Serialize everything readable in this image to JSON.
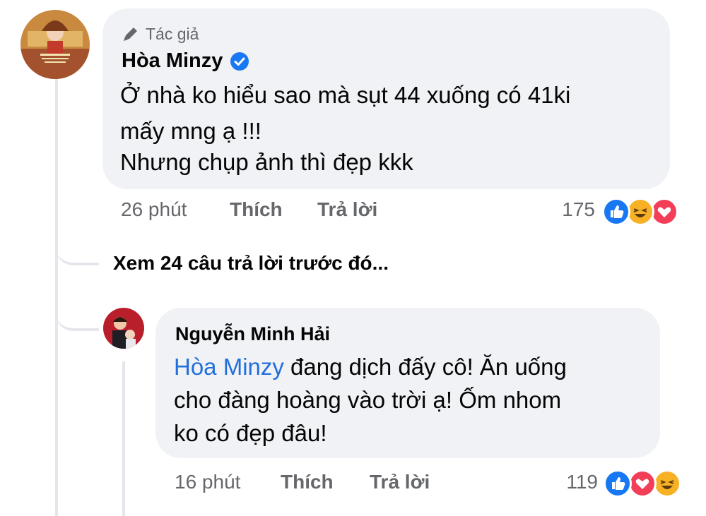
{
  "comment": {
    "author_badge": "Tác giả",
    "author_name": "Hòa Minzy",
    "lines": [
      "Ở nhà ko hiểu sao mà sụt 44 xuống có 41ki",
      "mấy mng ạ !!!",
      "Nhưng chụp ảnh thì đẹp kkk"
    ],
    "time": "26 phút",
    "like_label": "Thích",
    "reply_label": "Trả lời",
    "reaction_count": "175",
    "reactions": [
      "like-icon",
      "haha-icon",
      "love-icon"
    ]
  },
  "see_more": "Xem 24 câu trả lời trước đó...",
  "reply": {
    "author_name": "Nguyễn Minh Hải",
    "mention": "Hòa Minzy",
    "line1_rest": " đang dịch đấy cô! Ăn uống",
    "line2": "cho đàng hoàng vào trời ạ! Ốm nhom",
    "line3": "ko có đẹp đâu!",
    "time": "16 phút",
    "like_label": "Thích",
    "reply_label": "Trả lời",
    "reaction_count": "119",
    "reactions": [
      "like-icon",
      "love-icon",
      "haha-icon"
    ]
  },
  "colors": {
    "like": "#1877f2",
    "love": "#f33e58",
    "haha": "#f7b125",
    "mention": "#216fdb",
    "bubble": "#f0f2f5",
    "secondary_text": "#65676b"
  }
}
